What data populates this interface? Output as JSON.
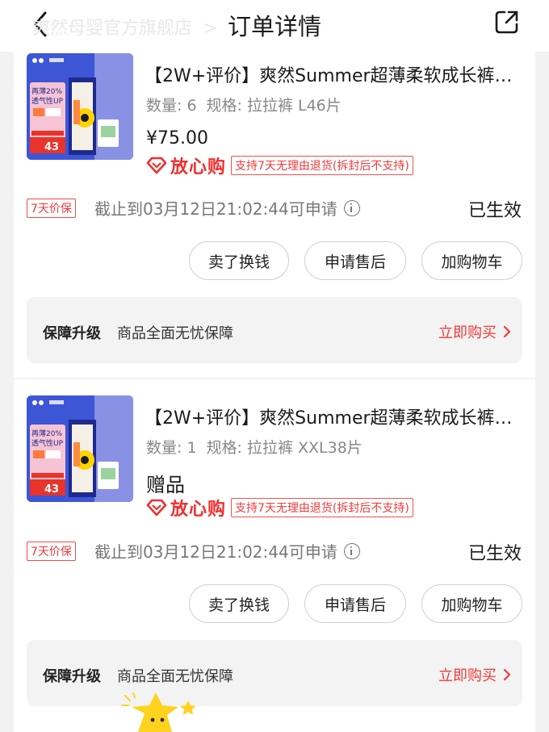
{
  "header": {
    "store_name": "爽然母婴官方旗舰店",
    "store_chevron": ">",
    "title": "订单详情"
  },
  "orders": [
    {
      "product_name": "【2W+评价】爽然Summer超薄柔软成长裤…",
      "quantity": "数量: 6",
      "spec": "规格: 拉拉裤 L46片",
      "price": "¥75.00",
      "assure_label": "放心购",
      "assure_tag": "支持7天无理由退货(拆封后不支持)",
      "price_protect_badge": "7天价保",
      "deadline": "截止到03月12日21:02:44可申请",
      "status": "已生效",
      "buttons": [
        "卖了换钱",
        "申请售后",
        "加购物车"
      ],
      "upgrade_title": "保障升级",
      "upgrade_desc": "商品全面无忧保障",
      "upgrade_link": "立即购买"
    },
    {
      "product_name": "【2W+评价】爽然Summer超薄柔软成长裤…",
      "quantity": "数量: 1",
      "spec": "规格: 拉拉裤 XXL38片",
      "gift_label": "赠品",
      "assure_label": "放心购",
      "assure_tag": "支持7天无理由退货(拆封后不支持)",
      "price_protect_badge": "7天价保",
      "deadline": "截止到03月12日21:02:44可申请",
      "status": "已生效",
      "buttons": [
        "卖了换钱",
        "申请售后",
        "加购物车"
      ],
      "upgrade_title": "保障升级",
      "upgrade_desc": "商品全面无忧保障",
      "upgrade_link": "立即购买"
    }
  ],
  "thumbnail": {
    "line1": "再薄20%",
    "line2": "透气性UP",
    "price": "43",
    "colors": {
      "background": "#3d56d6",
      "card": "#f6c4d4",
      "accent_red": "#e8342b"
    }
  },
  "colors": {
    "accent_red": "#f03a3a",
    "page_bg": "#f2f2f2"
  }
}
